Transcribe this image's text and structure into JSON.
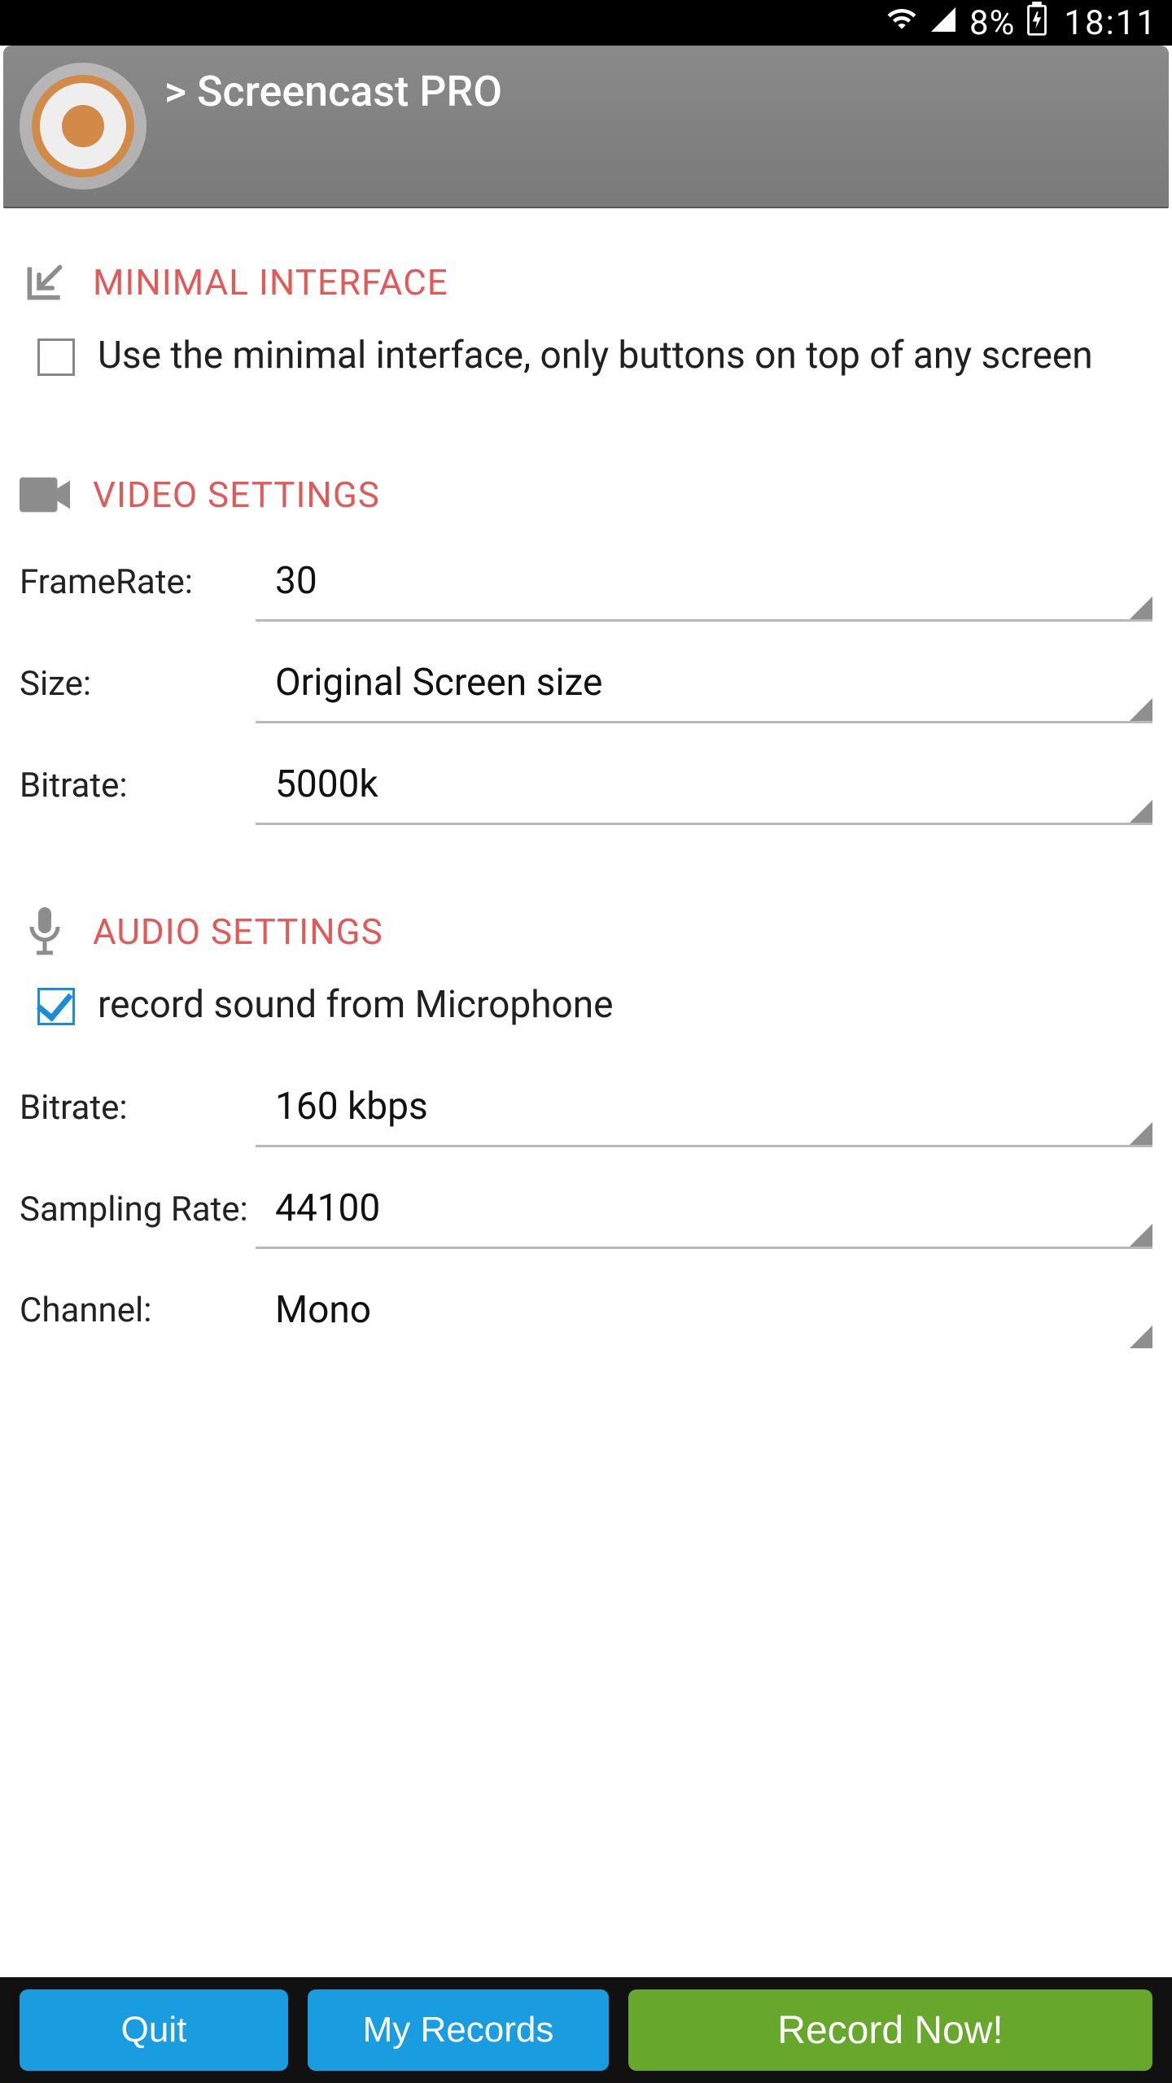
{
  "status": {
    "battery": "8%",
    "time": "18:11"
  },
  "header": {
    "title": "> Screencast PRO"
  },
  "sections": {
    "minimal": {
      "title": "MINIMAL INTERFACE",
      "check_label": "Use the minimal interface, only buttons on top of any screen",
      "checked": false
    },
    "video": {
      "title": "VIDEO SETTINGS",
      "rows": {
        "framerate": {
          "label": "FrameRate:",
          "value": "30"
        },
        "size": {
          "label": "Size:",
          "value": "Original Screen size"
        },
        "bitrate": {
          "label": "Bitrate:",
          "value": "5000k"
        }
      }
    },
    "audio": {
      "title": "AUDIO SETTINGS",
      "check_label": "record sound from Microphone",
      "checked": true,
      "rows": {
        "bitrate": {
          "label": "Bitrate:",
          "value": "160 kbps"
        },
        "sampling": {
          "label": "Sampling Rate:",
          "value": "44100"
        },
        "channel": {
          "label": "Channel:",
          "value": "Mono"
        }
      }
    }
  },
  "buttons": {
    "quit": "Quit",
    "records": "My Records",
    "record": "Record Now!"
  }
}
